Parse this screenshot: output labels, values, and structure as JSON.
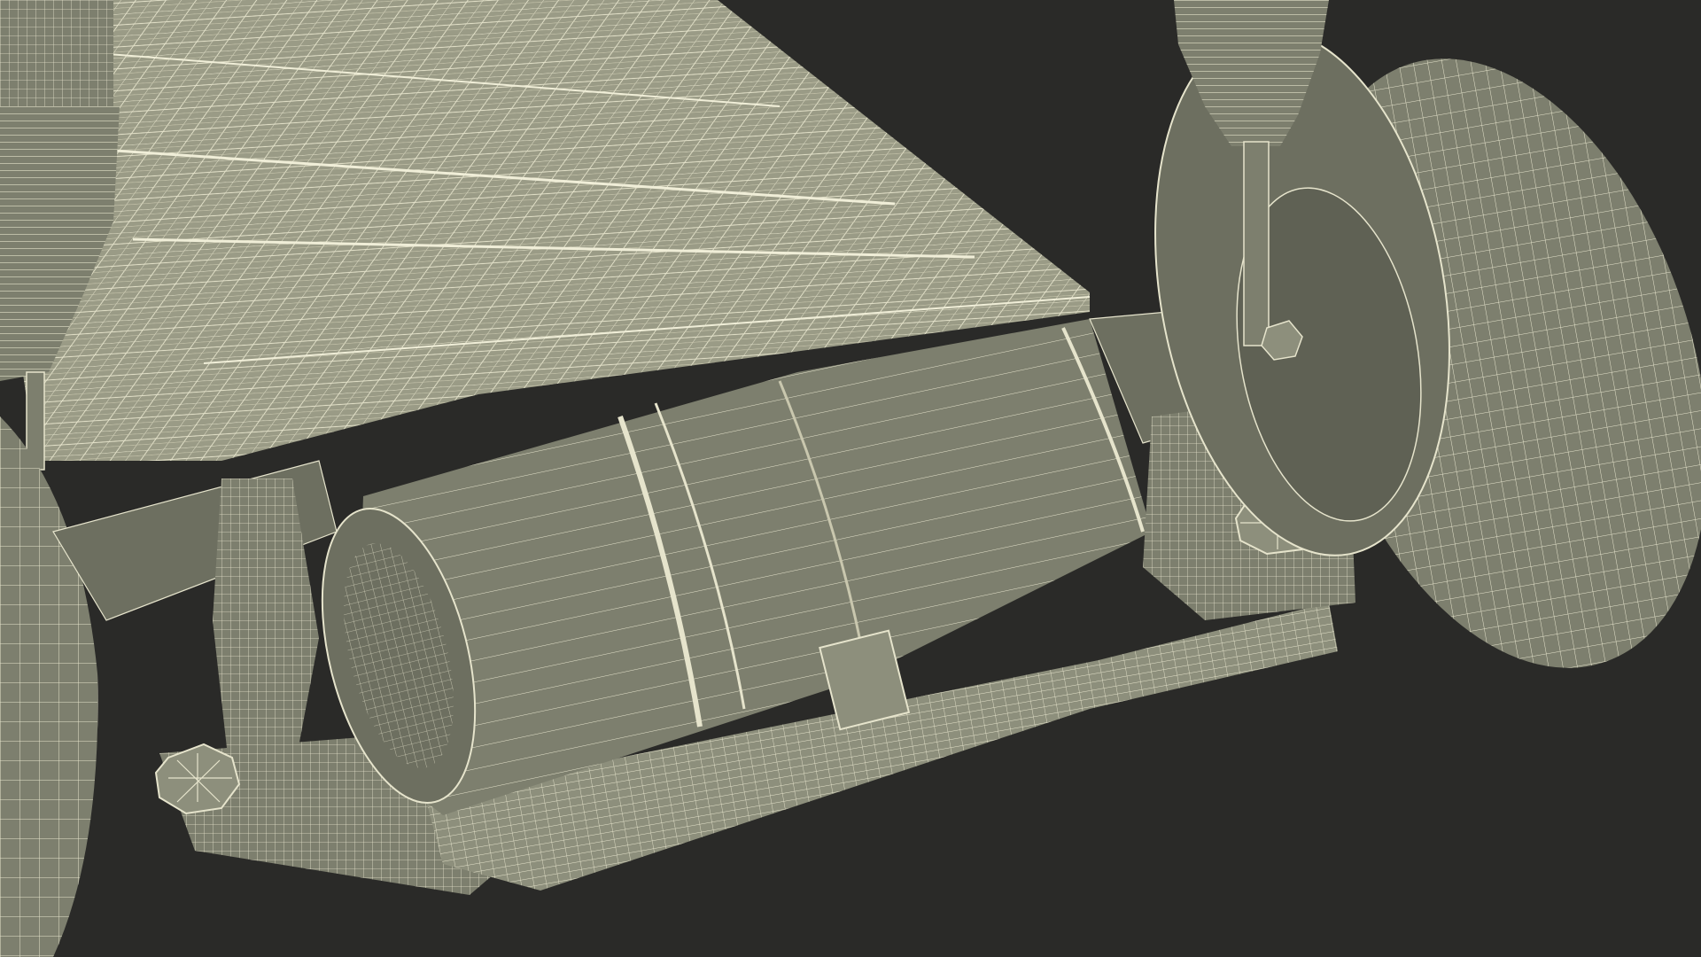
{
  "scene": {
    "colors": {
      "background": "#2a2a28",
      "surface": "#7d7f6e",
      "surface_dark": "#6d6f60",
      "surface_light": "#8d8f7c",
      "platform": "#9a9b86",
      "wire": "#e6e4cc",
      "wire_dim": "#c9c7ae"
    }
  }
}
